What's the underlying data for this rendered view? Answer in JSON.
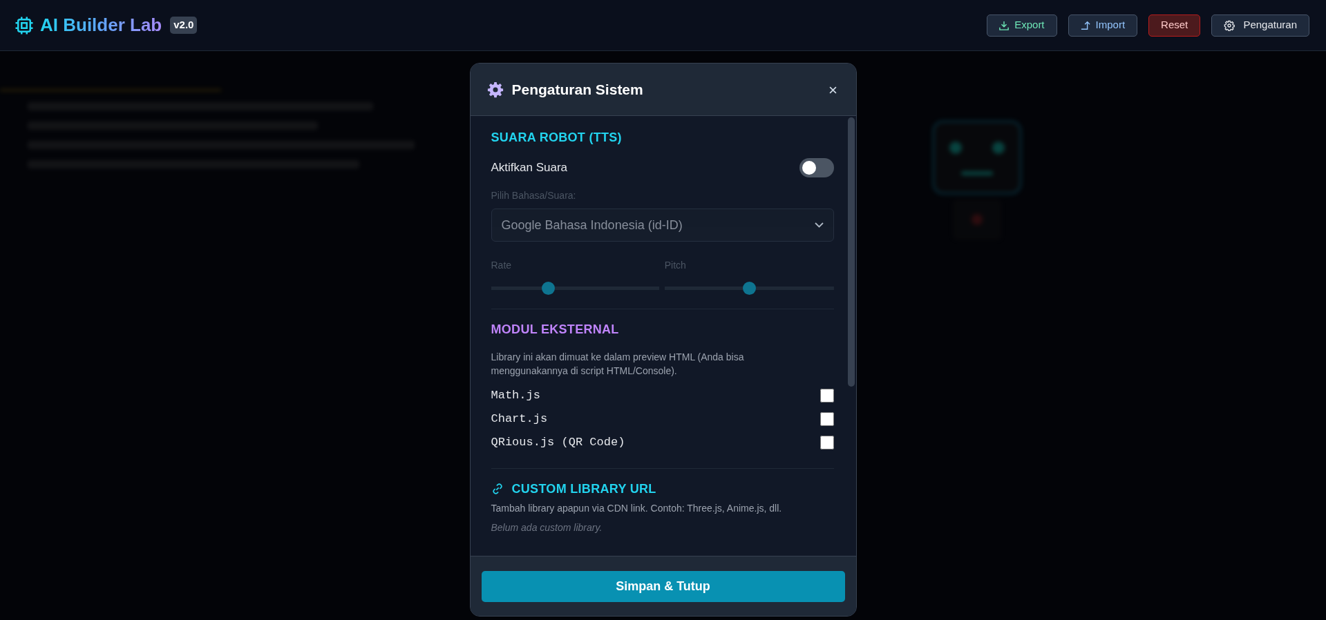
{
  "app": {
    "title": "AI Builder Lab",
    "version": "v2.0"
  },
  "header_buttons": [
    {
      "label": "Export",
      "kind": "export"
    },
    {
      "label": "Import",
      "kind": "import"
    },
    {
      "label": "Reset",
      "kind": "reset"
    },
    {
      "label": "Pengaturan",
      "kind": "settings"
    }
  ],
  "modal": {
    "title": "Pengaturan Sistem",
    "tts": {
      "heading": "SUARA ROBOT (TTS)",
      "toggle": {
        "label": "Aktifkan Suara",
        "on": false
      },
      "voice": {
        "label": "Pilih Bahasa/Suara:",
        "value": "Google Bahasa Indonesia (id-ID)",
        "disabled": true
      },
      "sliders": [
        {
          "label": "Rate",
          "level": 0.34
        },
        {
          "label": "Pitch",
          "level": 0.5
        }
      ]
    },
    "modules": {
      "heading": "MODUL EKSTERNAL",
      "description": "Library ini akan dimuat ke dalam preview HTML (Anda bisa menggunakannya di script HTML/Console).",
      "items": [
        {
          "label": "Math.js",
          "checked": false
        },
        {
          "label": "Chart.js",
          "checked": false
        },
        {
          "label": "QRious.js (QR Code)",
          "checked": false
        }
      ]
    },
    "custom": {
      "heading": "CUSTOM LIBRARY URL",
      "description": "Tambah library apapun via CDN link. Contoh: Three.js, Anime.js, dll.",
      "empty_text": "Belum ada custom library."
    },
    "save_button": "Simpan & Tutup"
  }
}
